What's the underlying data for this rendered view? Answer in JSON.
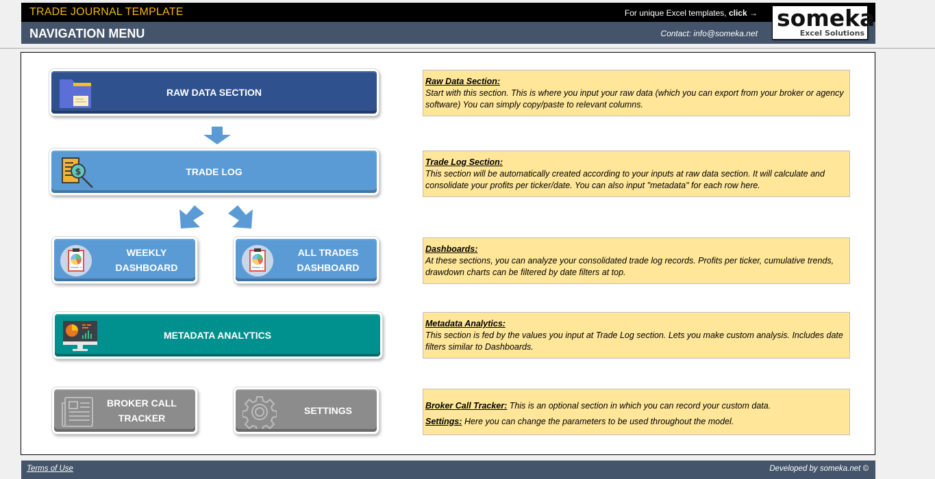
{
  "header": {
    "app_title": "TRADE JOURNAL TEMPLATE",
    "promo_text": "For unique Excel templates,",
    "promo_link": "click →",
    "nav_title": "NAVIGATION MENU",
    "contact": "Contact: info@someka.net",
    "logo_main": "someka",
    "logo_sub": "Excel Solutions"
  },
  "buttons": {
    "raw_data": {
      "label": "RAW DATA SECTION",
      "icon": "folder-icon"
    },
    "trade_log": {
      "label": "TRADE LOG",
      "icon": "dollar-search-icon"
    },
    "weekly_dashboard": {
      "line1": "WEEKLY",
      "line2": "DASHBOARD",
      "icon": "clipboard-pie-icon"
    },
    "all_trades_dashboard": {
      "line1": "ALL TRADES",
      "line2": "DASHBOARD",
      "icon": "clipboard-pie-icon"
    },
    "metadata_analytics": {
      "label": "METADATA ANALYTICS",
      "icon": "monitor-chart-icon"
    },
    "broker_call_tracker": {
      "line1": "BROKER CALL",
      "line2": "TRACKER",
      "icon": "newspaper-icon"
    },
    "settings": {
      "label": "SETTINGS",
      "icon": "gear-icon"
    }
  },
  "descriptions": {
    "raw_data": {
      "title": "Raw Data Section:",
      "text": "Start with this section. This is where you input your raw data (which you can export from your broker or agency software) You can simply copy/paste to relevant columns."
    },
    "trade_log": {
      "title": "Trade Log Section:",
      "text": "This section will be automatically created according to your inputs at raw data section. It will calculate and consolidate your profits per ticker/date. You can also input \"metadata\" for each row here."
    },
    "dashboards": {
      "title": "Dashboards:",
      "text": "At these sections, you can analyze your consolidated trade log records. Profits per ticker, cumulative trends, drawdown charts can be filtered by date filters at top."
    },
    "metadata": {
      "title": "Metadata Analytics:",
      "text": "This section is fed by the values you input at Trade Log section. Lets you make custom analysis. Includes date filters similar to Dashboards."
    },
    "broker": {
      "title": "Broker Call Tracker:",
      "text": " This is an optional section in which you can record your custom data."
    },
    "settings": {
      "title": "Settings:",
      "text": " Here you can change the parameters to be used throughout the model."
    }
  },
  "footer": {
    "terms": "Terms of Use",
    "developed_by": "Developed by someka.net ©"
  },
  "colors": {
    "title_gold": "#f5b800",
    "header_slate": "#44546a",
    "raw_data_blue": "#2f528f",
    "section_blue": "#5b9bd5",
    "analytics_teal": "#00918e",
    "utility_grey": "#8c8c8c",
    "description_yellow": "#ffe699"
  }
}
